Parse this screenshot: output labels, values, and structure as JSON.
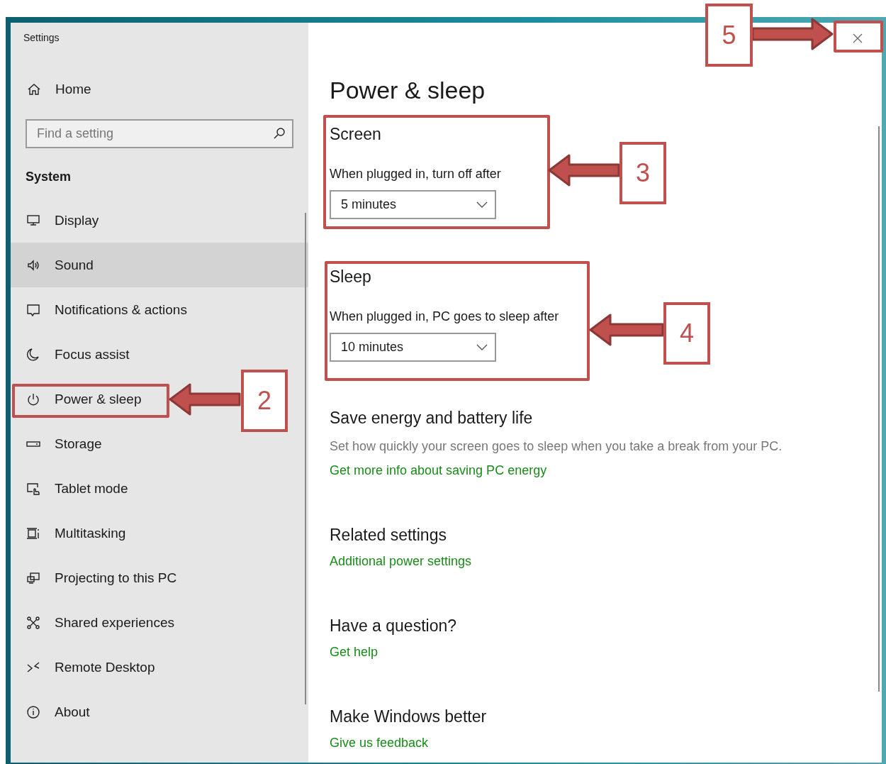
{
  "window": {
    "title": "Settings"
  },
  "sidebar": {
    "home": "Home",
    "search": {
      "placeholder": "Find a setting"
    },
    "section": "System",
    "items": [
      {
        "label": "Display",
        "selected": false
      },
      {
        "label": "Sound",
        "selected": true
      },
      {
        "label": "Notifications & actions",
        "selected": false
      },
      {
        "label": "Focus assist",
        "selected": false
      },
      {
        "label": "Power & sleep",
        "selected": false
      },
      {
        "label": "Storage",
        "selected": false
      },
      {
        "label": "Tablet mode",
        "selected": false
      },
      {
        "label": "Multitasking",
        "selected": false
      },
      {
        "label": "Projecting to this PC",
        "selected": false
      },
      {
        "label": "Shared experiences",
        "selected": false
      },
      {
        "label": "Remote Desktop",
        "selected": false
      },
      {
        "label": "About",
        "selected": false
      }
    ]
  },
  "content": {
    "title": "Power & sleep",
    "groups": [
      {
        "heading": "Screen",
        "label": "When plugged in, turn off after",
        "value": "5 minutes"
      },
      {
        "heading": "Sleep",
        "label": "When plugged in, PC goes to sleep after",
        "value": "10 minutes"
      }
    ],
    "sections": [
      {
        "heading": "Save energy and battery life",
        "text": "Set how quickly your screen goes to sleep when you take a break from your PC.",
        "link": "Get more info about saving PC energy"
      },
      {
        "heading": "Related settings",
        "link": "Additional power settings"
      },
      {
        "heading": "Have a question?",
        "link": "Get help"
      },
      {
        "heading": "Make Windows better",
        "link": "Give us feedback"
      }
    ]
  },
  "annotations": [
    {
      "number": "2"
    },
    {
      "number": "3"
    },
    {
      "number": "4"
    },
    {
      "number": "5"
    }
  ]
}
